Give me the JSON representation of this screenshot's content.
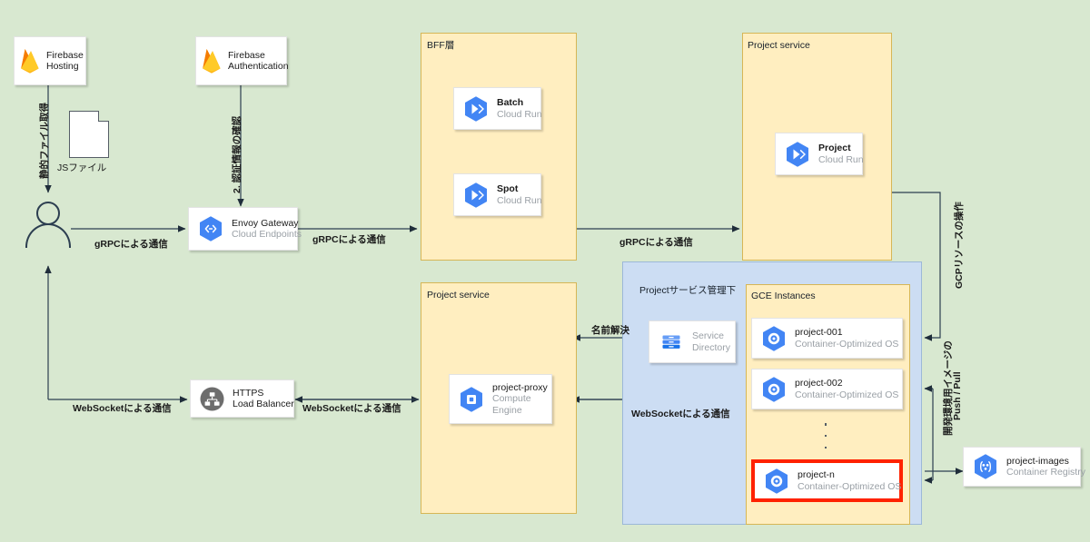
{
  "diagram": {
    "background_color": "#d8e8d0",
    "groups": [
      {
        "id": "bff",
        "title": "BFF層"
      },
      {
        "id": "project_top",
        "title": "Project service"
      },
      {
        "id": "project_bottom",
        "title": "Project service"
      },
      {
        "id": "managed",
        "title": "Projectサービス管理下"
      },
      {
        "id": "gce",
        "title": "GCE Instances"
      }
    ],
    "nodes": {
      "firebase_hosting": {
        "title": "Firebase",
        "subtitle": "Hosting",
        "icon": "firebase-icon"
      },
      "firebase_auth": {
        "title": "Firebase",
        "subtitle": "Authentication",
        "icon": "firebase-icon"
      },
      "js_file": {
        "label": "JSファイル",
        "icon": "document-note-icon"
      },
      "user": {
        "label": "user-actor",
        "icon": "user-actor-icon"
      },
      "envoy_gateway": {
        "title": "Envoy Gateway",
        "subtitle": "Cloud Endpoints",
        "icon": "cloud-endpoints-icon"
      },
      "https_lb": {
        "title": "HTTPS",
        "subtitle": "Load Balancer",
        "icon": "load-balancer-icon"
      },
      "batch": {
        "title": "Batch",
        "subtitle": "Cloud Run",
        "icon": "cloud-run-icon"
      },
      "spot": {
        "title": "Spot",
        "subtitle": "Cloud Run",
        "icon": "cloud-run-icon"
      },
      "project_run": {
        "title": "Project",
        "subtitle": "Cloud Run",
        "icon": "cloud-run-icon"
      },
      "project_proxy": {
        "title": "project-proxy",
        "subtitle": "Compute\nEngine",
        "subtitle_line1": "Compute",
        "subtitle_line2": "Engine",
        "icon": "compute-engine-icon"
      },
      "service_directory": {
        "title": "Service",
        "subtitle": "Directory",
        "icon": "service-directory-icon"
      },
      "project_001": {
        "title": "project-001",
        "subtitle": "Container-Optimized OS",
        "icon": "compute-instance-icon"
      },
      "project_002": {
        "title": "project-002",
        "subtitle": "Container-Optimized OS",
        "icon": "compute-instance-icon"
      },
      "project_n": {
        "title": "project-n",
        "subtitle": "Container-Optimized OS",
        "icon": "compute-instance-icon",
        "highlight_color": "#ff2200"
      },
      "project_images": {
        "title": "project-images",
        "subtitle": "Container Registry",
        "icon": "container-registry-icon"
      },
      "ellipsis": {
        "label": "⋮"
      }
    },
    "edge_labels": {
      "static_files": "静的ファイル取得",
      "auth_check": "2. 認証情報の確認",
      "grpc_user_envoy": "gRPCによる通信",
      "grpc_envoy_bff": "gRPCによる通信",
      "grpc_bff_project": "gRPCによる通信",
      "ws_user_lb": "WebSocketによる通信",
      "ws_lb_proxy": "WebSocketによる通信",
      "ws_proxy_gce": "WebSocketによる通信",
      "name_resolution": "名前解決",
      "gcp_resource_ops": "GCPリソースの操作",
      "image_push_pull_l1": "開発環境用イメージの",
      "image_push_pull_l2": "Push / Pull"
    }
  }
}
